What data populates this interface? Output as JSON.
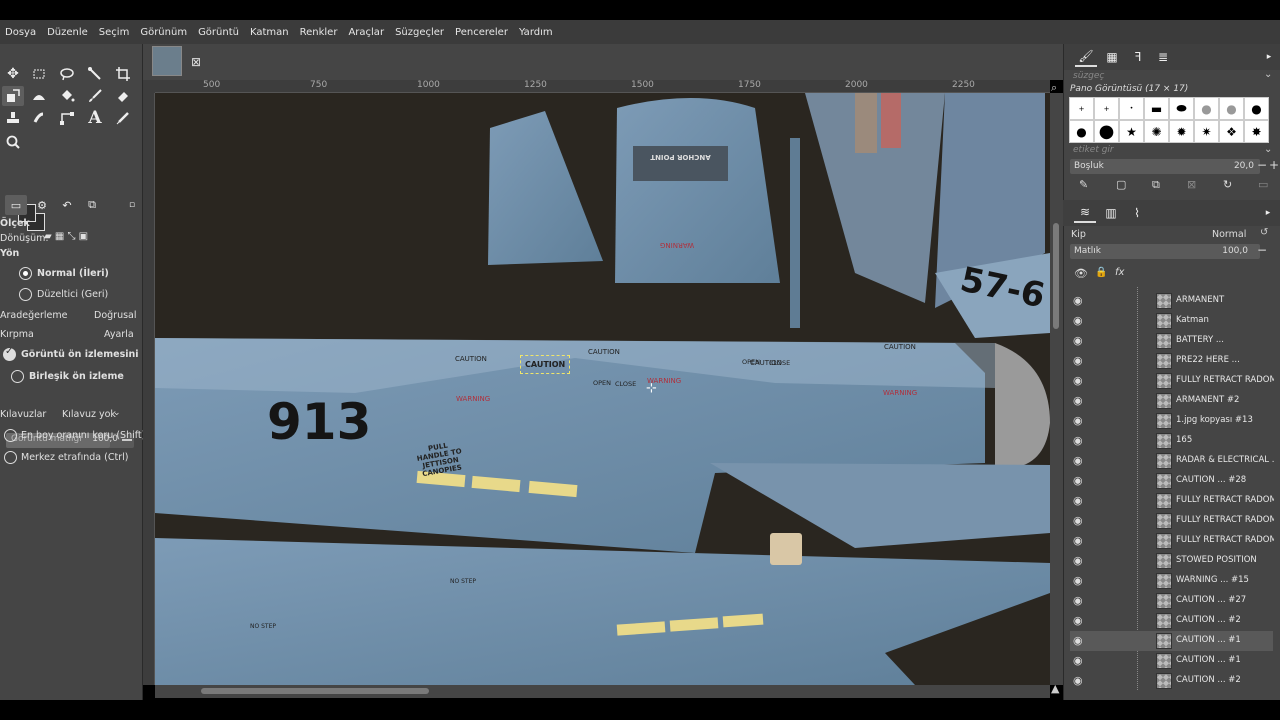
{
  "menu": [
    "Dosya",
    "Düzenle",
    "Seçim",
    "Görünüm",
    "Görüntü",
    "Katman",
    "Renkler",
    "Araçlar",
    "Süzgeçler",
    "Pencereler",
    "Yardım"
  ],
  "tab": {
    "close_glyph": "⊠"
  },
  "ruler": {
    "h_labels": [
      "500",
      "750",
      "1000",
      "1250",
      "1500",
      "1750",
      "2000",
      "2250"
    ]
  },
  "tool_options": {
    "title": "Ölçek",
    "transform_label": "Dönüşüm:",
    "direction_label": "Yön",
    "direction_normal": "Normal (İleri)",
    "direction_corrective": "Düzeltici (Geri)",
    "interpolation_label": "Aradeğerleme",
    "interpolation_value": "Doğrusal",
    "clipping_label": "Kırpma",
    "clipping_value": "Ayarla",
    "show_preview": "Görüntü ön izlemesini göste",
    "composited_preview": "Birleşik ön izleme",
    "opacity_label": "Görüntü matlığı",
    "opacity_value": "100,0",
    "guides_label": "Kılavuzlar",
    "guides_value": "Kılavuz yok",
    "keep_aspect": "En boy oranını koru (Shift)",
    "around_center": "Merkez etrafında (Ctrl)"
  },
  "brushes": {
    "filter_placeholder": "süzgeç",
    "brush_name": "Pano Görüntüsü (17 × 17)",
    "tag_placeholder": "etiket gir",
    "spacing_label": "Boşluk",
    "spacing_value": "20,0"
  },
  "layers": {
    "mode_label": "Kip",
    "mode_value": "Normal",
    "opacity_label": "Matlık",
    "opacity_value": "100,0",
    "items": [
      {
        "name": "ARMANENT",
        "active": false
      },
      {
        "name": "Katman",
        "active": false
      },
      {
        "name": "BATTERY ...",
        "active": false
      },
      {
        "name": "PRE22 HERE ...",
        "active": false
      },
      {
        "name": "FULLY RETRACT RADOM",
        "active": false
      },
      {
        "name": "ARMANENT #2",
        "active": false
      },
      {
        "name": "1.jpg kopyası #13",
        "active": false
      },
      {
        "name": "165",
        "active": false
      },
      {
        "name": "RADAR & ELECTRICAL ...",
        "active": false
      },
      {
        "name": "CAUTION ... #28",
        "active": false
      },
      {
        "name": "FULLY RETRACT RADOM",
        "active": false
      },
      {
        "name": "FULLY RETRACT RADOM",
        "active": false
      },
      {
        "name": "FULLY RETRACT RADOM",
        "active": false
      },
      {
        "name": "STOWED POSITION",
        "active": false
      },
      {
        "name": "WARNING ... #15",
        "active": false
      },
      {
        "name": "CAUTION ... #27",
        "active": false
      },
      {
        "name": "CAUTION ... #2",
        "active": false
      },
      {
        "name": "CAUTION ... #1",
        "active": true
      },
      {
        "name": "CAUTION ... #1",
        "active": false
      },
      {
        "name": "CAUTION ... #2",
        "active": false
      }
    ]
  },
  "canvas_text": {
    "big_number": "913",
    "tail_number": "57-6",
    "caution": "CAUTION",
    "warning": "WARNING",
    "open": "OPEN",
    "close": "CLOSE",
    "pull_handle": "PULL HANDLE TO JETTISON CANOPIES",
    "anchor": "ANCHOR POINT",
    "no_step": "NO STEP"
  }
}
